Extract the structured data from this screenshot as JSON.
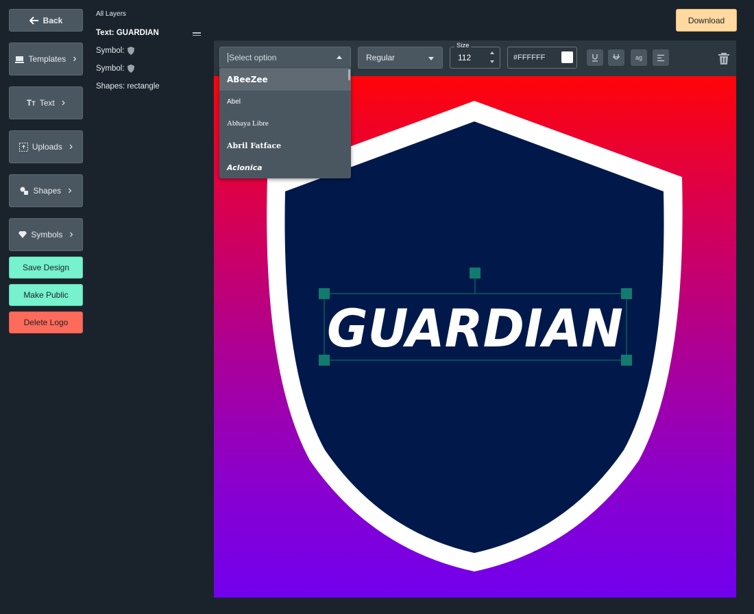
{
  "sidebar": {
    "back_label": "Back",
    "templates_label": "Templates",
    "text_label": "Text",
    "uploads_label": "Uploads",
    "shapes_label": "Shapes",
    "symbols_label": "Symbols",
    "save_label": "Save Design",
    "public_label": "Make Public",
    "delete_label": "Delete Logo"
  },
  "layers": {
    "title": "All Layers",
    "items": [
      {
        "label": "Text: GUARDIAN"
      },
      {
        "label": "Symbol:"
      },
      {
        "label": "Symbol:"
      },
      {
        "label": "Shapes: rectangle"
      }
    ]
  },
  "header": {
    "download_label": "Download"
  },
  "toolbar": {
    "font_placeholder": "Select option",
    "weight_value": "Regular",
    "size_label": "Size",
    "size_value": "112",
    "color_value": "#FFFFFF",
    "underline_icon": "underline-icon",
    "strike_icon": "strikethrough-icon",
    "case_label": "ag",
    "align_icon": "align-left-icon",
    "trash_icon": "trash-icon"
  },
  "font_dropdown": {
    "options": [
      "ABeeZee",
      "Abel",
      "Abhaya Libre",
      "Abril Fatface",
      "Aclonica"
    ]
  },
  "canvas": {
    "text": "GUARDIAN",
    "gradient_top": "#ff0409",
    "gradient_bottom": "#7200ee",
    "shield_fill": "#00194a",
    "shield_border": "#ffffff",
    "text_color": "#ffffff",
    "handle_color": "#127a6e"
  }
}
